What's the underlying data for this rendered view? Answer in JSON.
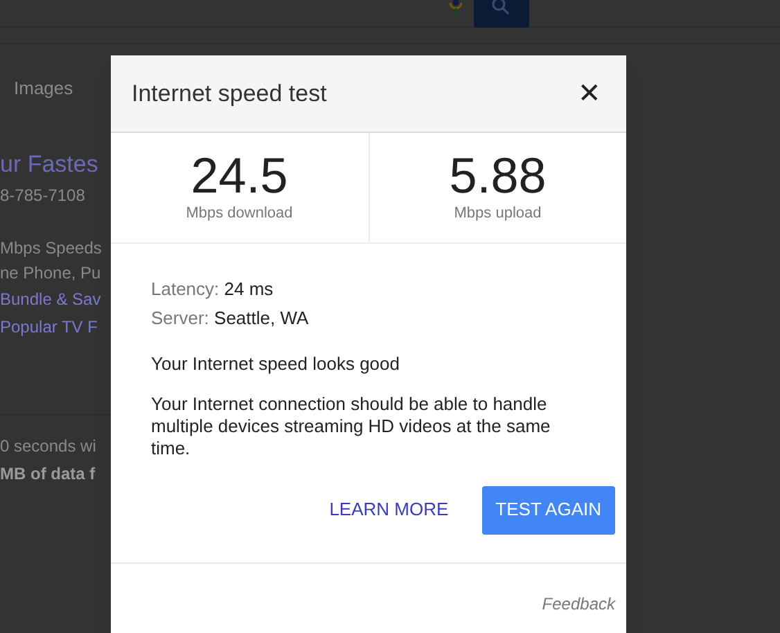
{
  "background": {
    "tab": "Images",
    "result_lines": [
      {
        "kind": "title",
        "text": "ur Fastes"
      },
      {
        "kind": "plain",
        "text": "8-785-7108"
      },
      {
        "kind": "gap"
      },
      {
        "kind": "plain",
        "text": "Mbps Speeds"
      },
      {
        "kind": "plain",
        "text": "ne Phone, Pu"
      },
      {
        "kind": "link",
        "text": "Bundle & Sav"
      },
      {
        "kind": "link",
        "text": "Popular TV F"
      }
    ],
    "footer_lines": [
      {
        "kind": "plain",
        "text": "0 seconds wi"
      },
      {
        "kind": "bold",
        "text": "MB of data f"
      }
    ]
  },
  "dialog": {
    "title": "Internet speed test",
    "close": "✕",
    "results": [
      {
        "value": "24.5",
        "unit": "Mbps download"
      },
      {
        "value": "5.88",
        "unit": "Mbps upload"
      }
    ],
    "details": [
      {
        "label": "Latency:",
        "value": "24 ms"
      },
      {
        "label": "Server:",
        "value": "Seattle, WA"
      }
    ],
    "verdict": "Your Internet speed looks good",
    "description": "Your Internet connection should be able to handle multiple devices streaming HD videos at the same time.",
    "buttons": [
      {
        "kind": "text",
        "label": "LEARN MORE"
      },
      {
        "kind": "filled",
        "label": "TEST AGAIN"
      }
    ],
    "feedback": "Feedback"
  }
}
